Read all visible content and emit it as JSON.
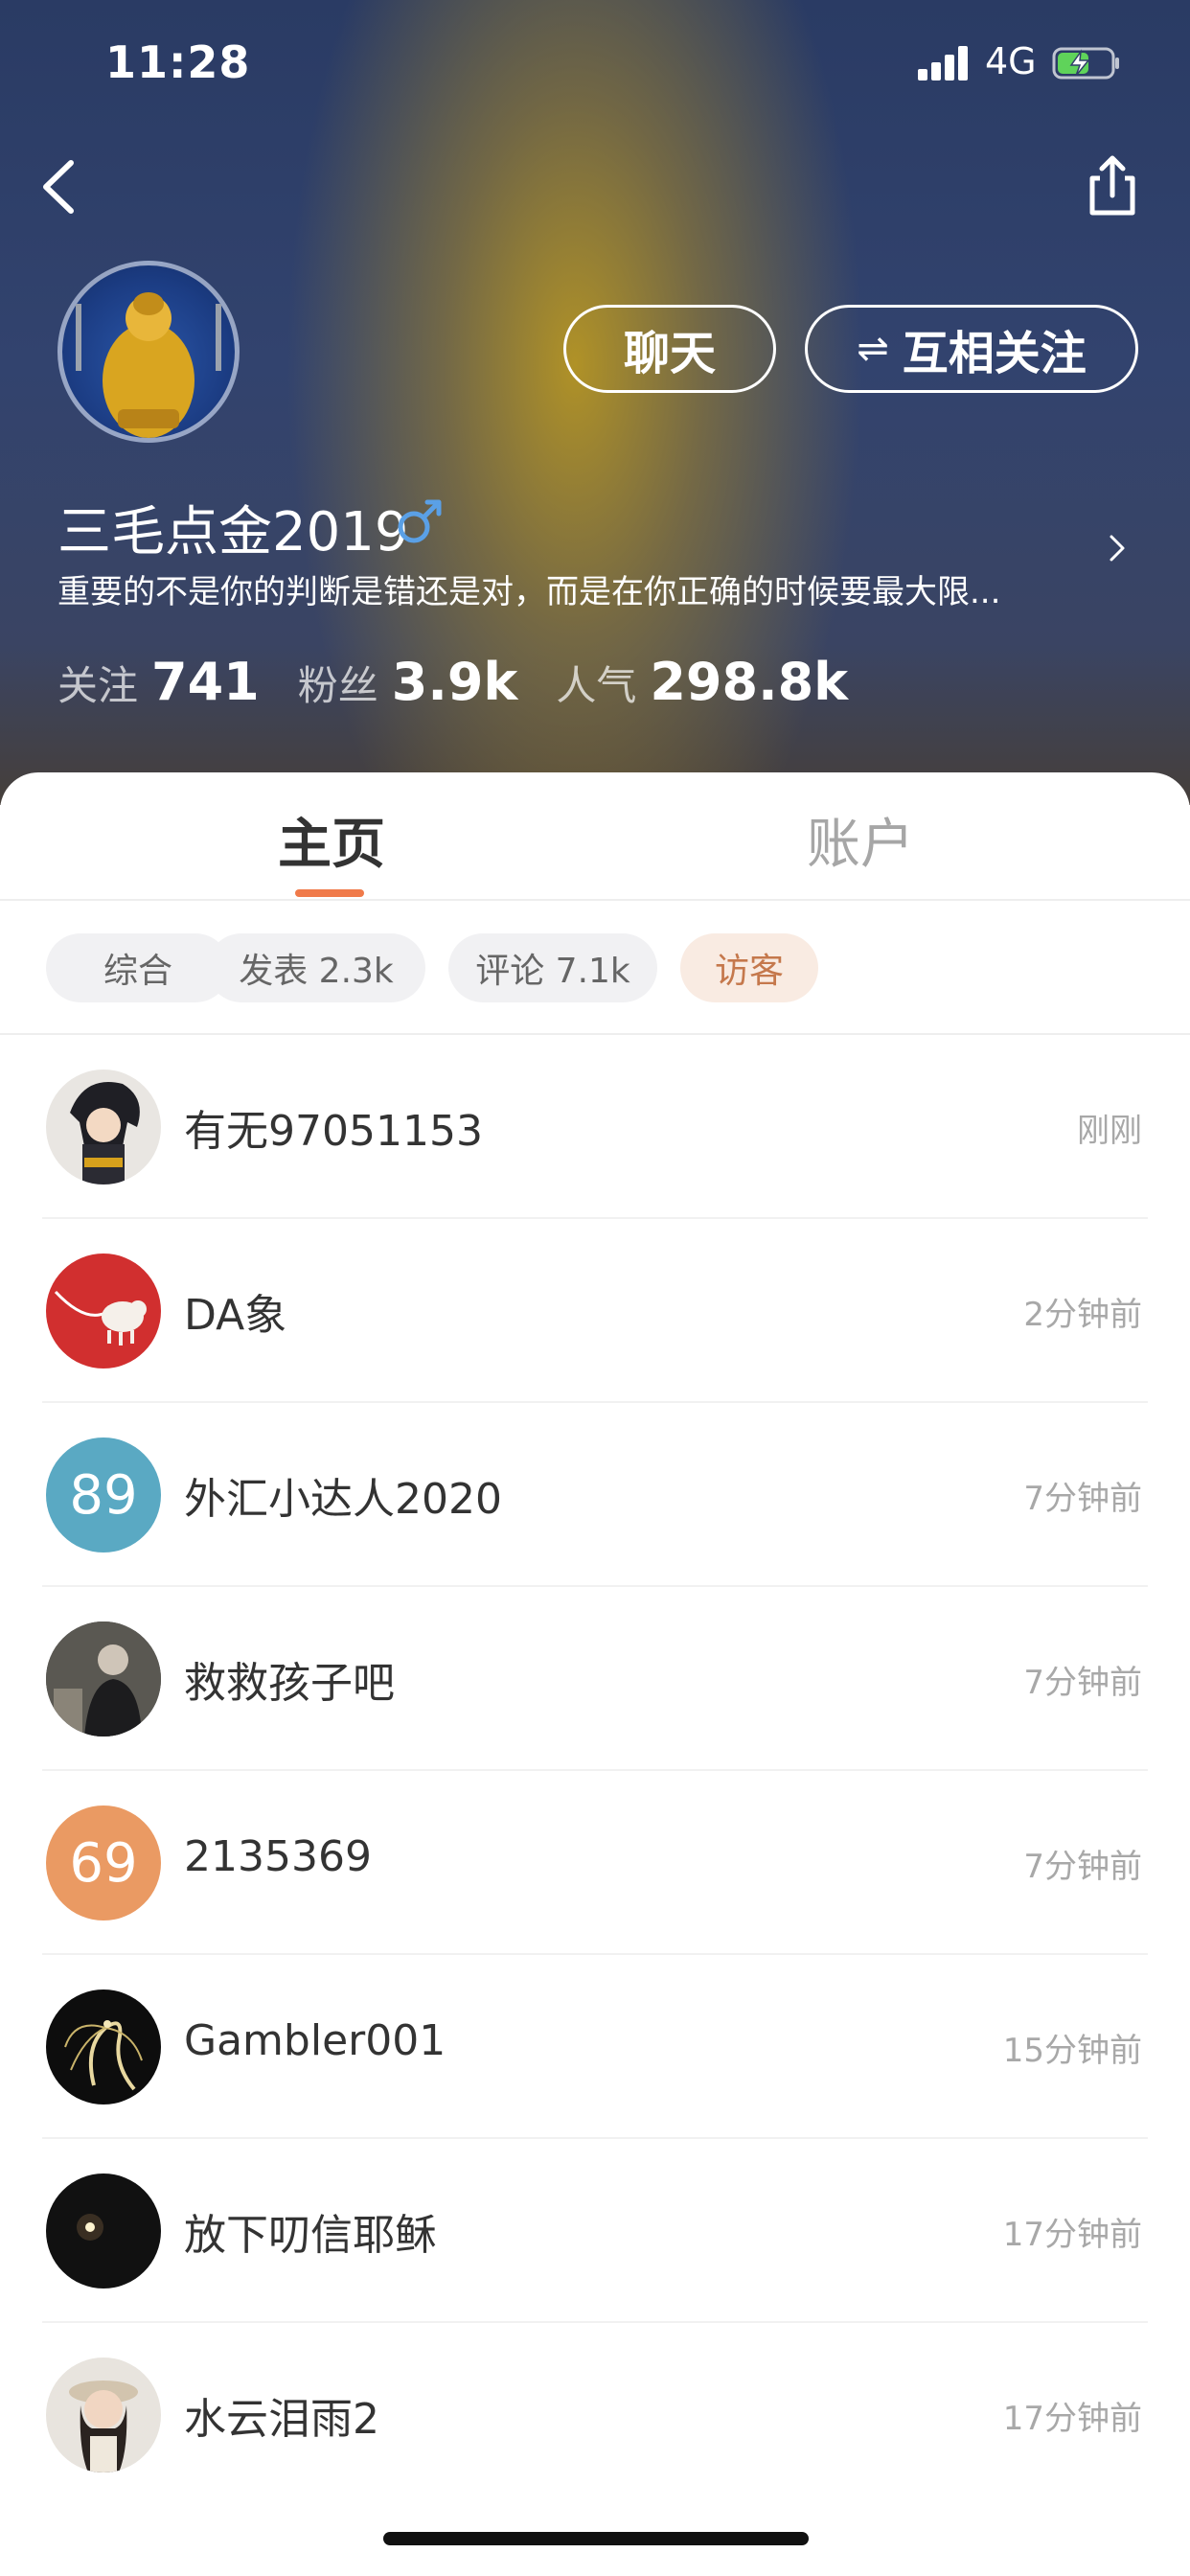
{
  "status_bar": {
    "time": "11:28",
    "network": "4G"
  },
  "profile": {
    "chat_label": "聊天",
    "follow_label": "互相关注",
    "follow_icon": "⇌",
    "username": "三毛点金2019",
    "gender_icon": "male-icon",
    "bio": "重要的不是你的判断是错还是对，而是在你正确的时候要最大限...",
    "stats": [
      {
        "label": "关注",
        "value": "741"
      },
      {
        "label": "粉丝",
        "value": "3.9k"
      },
      {
        "label": "人气",
        "value": "298.8k"
      }
    ]
  },
  "tabs": [
    {
      "label": "主页",
      "active": true
    },
    {
      "label": "账户",
      "active": false
    }
  ],
  "chips": [
    {
      "label": "综合",
      "active": false
    },
    {
      "label": "发表 2.3k",
      "active": false
    },
    {
      "label": "评论 7.1k",
      "active": false
    },
    {
      "label": "访客",
      "active": true
    }
  ],
  "visitors": [
    {
      "name": "有无97051153",
      "time": "刚刚",
      "avatar_text": ""
    },
    {
      "name": "DA象",
      "time": "2分钟前",
      "avatar_text": ""
    },
    {
      "name": "外汇小达人2020",
      "time": "7分钟前",
      "avatar_text": "89"
    },
    {
      "name": "救救孩子吧",
      "time": "7分钟前",
      "avatar_text": ""
    },
    {
      "name": "2135369",
      "time": "7分钟前",
      "avatar_text": "69"
    },
    {
      "name": "Gambler001",
      "time": "15分钟前",
      "avatar_text": ""
    },
    {
      "name": "放下叨信耶稣",
      "time": "17分钟前",
      "avatar_text": ""
    },
    {
      "name": "水云泪雨2",
      "time": "17分钟前",
      "avatar_text": ""
    }
  ],
  "colors": {
    "accent": "#f07a4a",
    "chip_active_text": "#c5784c",
    "avatar_89": "#5aa9c3",
    "avatar_69": "#ea9a63",
    "avatar_red": "#d12f2f"
  }
}
